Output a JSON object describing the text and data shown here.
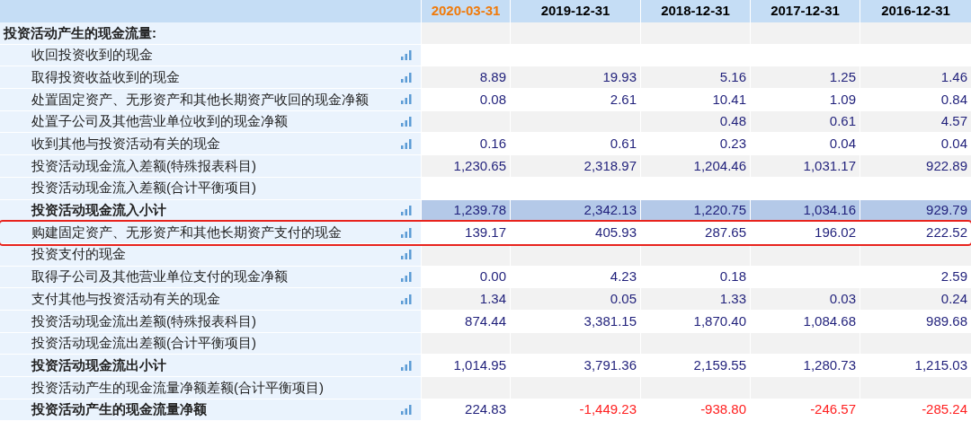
{
  "columns": [
    {
      "label": "2020-03-31",
      "selected": true
    },
    {
      "label": "2019-12-31",
      "selected": false
    },
    {
      "label": "2018-12-31",
      "selected": false
    },
    {
      "label": "2017-12-31",
      "selected": false
    },
    {
      "label": "2016-12-31",
      "selected": false
    }
  ],
  "rows": [
    {
      "kind": "section",
      "label": "投资活动产生的现金流量:",
      "chart": false,
      "shaded": false,
      "outlined": false
    },
    {
      "kind": "item",
      "label": "收回投资收到的现金",
      "chart": true,
      "shaded": false,
      "outlined": false
    },
    {
      "kind": "item",
      "label": "取得投资收益收到的现金",
      "chart": true,
      "shaded": false,
      "outlined": false,
      "values": {
        "col_1": "8.89",
        "col_2": "19.93",
        "col_3": "5.16",
        "col_4": "1.25",
        "col_5": "1.46"
      }
    },
    {
      "kind": "item",
      "label": "处置固定资产、无形资产和其他长期资产收回的现金净额",
      "chart": true,
      "shaded": false,
      "outlined": false,
      "values": {
        "col_1": "0.08",
        "col_2": "2.61",
        "col_3": "10.41",
        "col_4": "1.09",
        "col_5": "0.84"
      }
    },
    {
      "kind": "item",
      "label": "处置子公司及其他营业单位收到的现金净额",
      "chart": true,
      "shaded": false,
      "outlined": false,
      "values": {
        "col_3": "0.48",
        "col_4": "0.61",
        "col_5": "4.57"
      }
    },
    {
      "kind": "item",
      "label": "收到其他与投资活动有关的现金",
      "chart": true,
      "shaded": false,
      "outlined": false,
      "values": {
        "col_1": "0.16",
        "col_2": "0.61",
        "col_3": "0.23",
        "col_4": "0.04",
        "col_5": "0.04"
      }
    },
    {
      "kind": "item",
      "label": "投资活动现金流入差额(特殊报表科目)",
      "chart": false,
      "shaded": false,
      "outlined": false,
      "values": {
        "col_1": "1,230.65",
        "col_2": "2,318.97",
        "col_3": "1,204.46",
        "col_4": "1,031.17",
        "col_5": "922.89"
      }
    },
    {
      "kind": "item",
      "label": "投资活动现金流入差额(合计平衡项目)",
      "chart": false,
      "shaded": false,
      "outlined": false
    },
    {
      "kind": "subtotal",
      "label": "投资活动现金流入小计",
      "chart": true,
      "shaded": true,
      "outlined": false,
      "values": {
        "col_1": "1,239.78",
        "col_2": "2,342.13",
        "col_3": "1,220.75",
        "col_4": "1,034.16",
        "col_5": "929.79"
      }
    },
    {
      "kind": "item",
      "label": "购建固定资产、无形资产和其他长期资产支付的现金",
      "chart": true,
      "shaded": false,
      "outlined": true,
      "values": {
        "col_1": "139.17",
        "col_2": "405.93",
        "col_3": "287.65",
        "col_4": "196.02",
        "col_5": "222.52"
      }
    },
    {
      "kind": "item",
      "label": "投资支付的现金",
      "chart": true,
      "shaded": false,
      "outlined": false
    },
    {
      "kind": "item",
      "label": "取得子公司及其他营业单位支付的现金净额",
      "chart": true,
      "shaded": false,
      "outlined": false,
      "values": {
        "col_1": "0.00",
        "col_2": "4.23",
        "col_3": "0.18",
        "col_5": "2.59"
      }
    },
    {
      "kind": "item",
      "label": "支付其他与投资活动有关的现金",
      "chart": true,
      "shaded": false,
      "outlined": false,
      "values": {
        "col_1": "1.34",
        "col_2": "0.05",
        "col_3": "1.33",
        "col_4": "0.03",
        "col_5": "0.24"
      }
    },
    {
      "kind": "item",
      "label": "投资活动现金流出差额(特殊报表科目)",
      "chart": false,
      "shaded": false,
      "outlined": false,
      "values": {
        "col_1": "874.44",
        "col_2": "3,381.15",
        "col_3": "1,870.40",
        "col_4": "1,084.68",
        "col_5": "989.68"
      }
    },
    {
      "kind": "item",
      "label": "投资活动现金流出差额(合计平衡项目)",
      "chart": false,
      "shaded": false,
      "outlined": false
    },
    {
      "kind": "subtotal",
      "label": "投资活动现金流出小计",
      "chart": true,
      "shaded": false,
      "outlined": false,
      "values": {
        "col_1": "1,014.95",
        "col_2": "3,791.36",
        "col_3": "2,159.55",
        "col_4": "1,280.73",
        "col_5": "1,215.03"
      }
    },
    {
      "kind": "item",
      "label": "投资活动产生的现金流量净额差额(合计平衡项目)",
      "chart": false,
      "shaded": false,
      "outlined": false
    },
    {
      "kind": "subtotal",
      "label": "投资活动产生的现金流量净额",
      "chart": true,
      "shaded": false,
      "outlined": false,
      "negative": [
        false,
        true,
        true,
        true,
        true
      ],
      "values": {
        "col_1": "224.83",
        "col_2": "-1,449.23",
        "col_3": "-938.80",
        "col_4": "-246.57",
        "col_5": "-285.24"
      }
    }
  ]
}
